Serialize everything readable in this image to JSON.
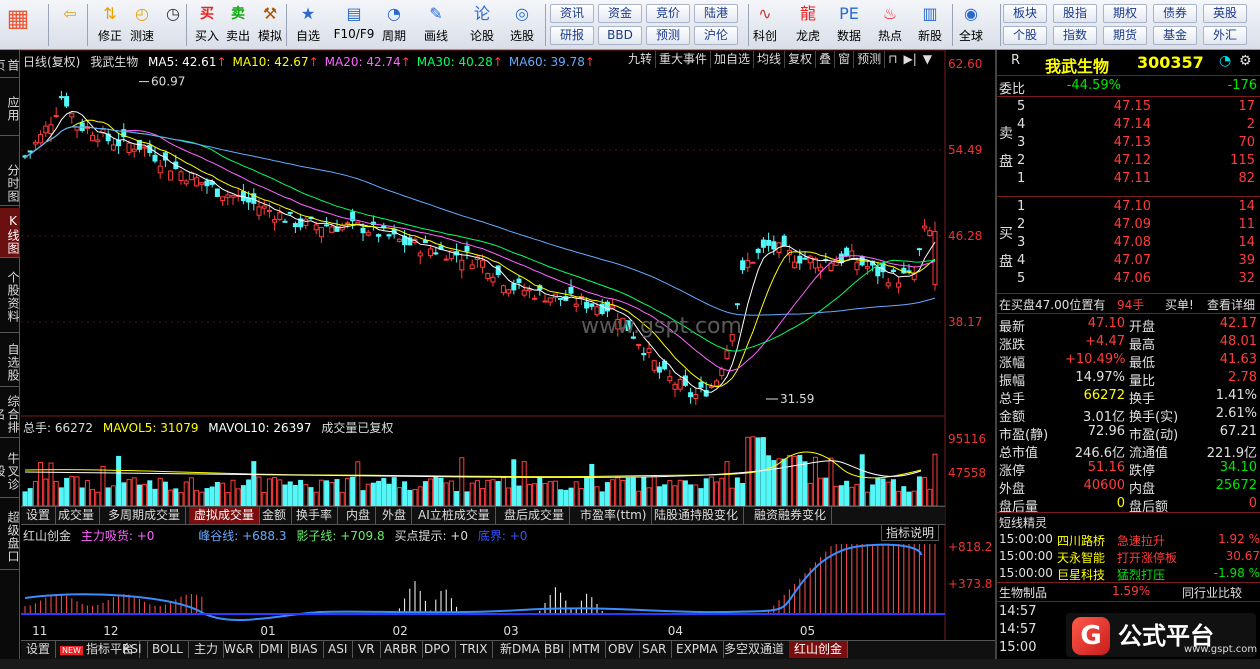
{
  "toolbar": {
    "buttons": [
      {
        "id": "layout",
        "label": "",
        "icon": "grid-icon"
      },
      {
        "id": "back",
        "label": "",
        "icon": "back-arrow-icon"
      },
      {
        "id": "revise",
        "label": "修正",
        "icon": "up-down-icon"
      },
      {
        "id": "test",
        "label": "测速",
        "icon": "speed-icon"
      },
      {
        "id": "stopwatch",
        "label": "",
        "icon": "clock-icon"
      },
      {
        "id": "buy",
        "label": "买入",
        "icon": "buy-icon"
      },
      {
        "id": "sell",
        "label": "卖出",
        "icon": "sell-icon"
      },
      {
        "id": "sim",
        "label": "模拟",
        "icon": "hammer-icon"
      },
      {
        "id": "fav",
        "label": "自选",
        "icon": "star-icon"
      },
      {
        "id": "f10",
        "label": "F10/F9",
        "icon": "info-icon"
      },
      {
        "id": "period",
        "label": "周期",
        "icon": "cycle-icon"
      },
      {
        "id": "draw",
        "label": "画线",
        "icon": "pencil-icon"
      },
      {
        "id": "forum",
        "label": "论股",
        "icon": "chat-icon"
      },
      {
        "id": "select",
        "label": "选股",
        "icon": "magnifier-icon"
      },
      {
        "id": "kechuang",
        "label": "科创",
        "icon": "chart-icon"
      },
      {
        "id": "dragon",
        "label": "龙虎",
        "icon": "dragon-icon"
      },
      {
        "id": "data",
        "label": "数据",
        "icon": "pe-icon"
      },
      {
        "id": "hot",
        "label": "热点",
        "icon": "fire-icon"
      },
      {
        "id": "newstock",
        "label": "新股",
        "icon": "doc-icon"
      },
      {
        "id": "global",
        "label": "全球",
        "icon": "globe-icon"
      }
    ],
    "grid": [
      [
        "资讯",
        "资金",
        "竞价",
        "陆港"
      ],
      [
        "研报",
        "BBD",
        "预测",
        "沪伦"
      ]
    ],
    "grid2": [
      [
        "板块",
        "股指",
        "期权",
        "债券",
        "基金"
      ],
      [
        "个股",
        "指数",
        "期货",
        "基金",
        "外汇"
      ]
    ],
    "grid2b": [
      "英股"
    ]
  },
  "sidebar": [
    "首页",
    "应用",
    "分时图",
    "K线图",
    "个股资料",
    "自选股",
    "综合排名",
    "牛叉诊股",
    "超级盘口"
  ],
  "chart": {
    "title": "日线(复权)",
    "stock_name": "我武生物",
    "ma": [
      {
        "label": "MA5: 42.61",
        "color": "#ffffff"
      },
      {
        "label": "MA10: 42.67",
        "color": "#ffff00"
      },
      {
        "label": "MA20: 42.74",
        "color": "#ff66ff"
      },
      {
        "label": "MA30: 40.28",
        "color": "#00ff66"
      },
      {
        "label": "MA60: 39.78",
        "color": "#66aaff"
      }
    ],
    "buttons": [
      "九转",
      "重大事件",
      "加自选",
      "均线",
      "复权",
      "叠",
      "窗",
      "预测"
    ],
    "axis": [
      "62.60",
      "54.49",
      "46.28",
      "38.17"
    ],
    "hi_label": "60.97",
    "lo_label": "31.59",
    "watermark": "www.gspt.com",
    "vol_legend": {
      "total": "总手: 66272",
      "mavol5": "MAVOL5: 31079",
      "mavol10": "MAVOL10: 26397",
      "note": "成交量已复权"
    },
    "vol_axis": [
      "95116",
      "47558"
    ],
    "ind_legend": {
      "name": "红山创金",
      "a": "主力吸货: +0",
      "b": "峰谷线: +688.3",
      "c": "影子线: +709.8",
      "d": "买点提示: +0",
      "e": "底界: +0"
    },
    "ind_axis": [
      "+818.2",
      "+373.8"
    ],
    "ind_btn": "指标说明",
    "dates": [
      {
        "l": "11",
        "x": 0.012
      },
      {
        "l": "12",
        "x": 0.089
      },
      {
        "l": "01",
        "x": 0.259
      },
      {
        "l": "02",
        "x": 0.402
      },
      {
        "l": "03",
        "x": 0.522
      },
      {
        "l": "04",
        "x": 0.7
      },
      {
        "l": "05",
        "x": 0.843
      }
    ]
  },
  "tabs": [
    "设置",
    "成交量",
    "多周期成交量",
    "虚拟成交量",
    "金额",
    "换手率",
    "内盘",
    "外盘",
    "AI立桩成交量",
    "盘后成交量",
    "市盈率(ttm)",
    "陆股通持股变化",
    "融资融券变化"
  ],
  "btabs": [
    "设置",
    "指标平台",
    "RSI",
    "BOLL",
    "主力",
    "W&R",
    "DMI",
    "BIAS",
    "ASI",
    "VR",
    "ARBR",
    "DPO",
    "TRIX",
    "新DMA",
    "BBI",
    "MTM",
    "OBV",
    "SAR",
    "EXPMA",
    "多空双通道",
    "红山创金"
  ],
  "quote": {
    "mark": "R",
    "name": "我武生物",
    "code": "300357",
    "weibi": "委比",
    "weibi_pct": "-44.59%",
    "weibi_n": "-176",
    "sell": [
      [
        "5",
        "47.15",
        "17"
      ],
      [
        "4",
        "47.14",
        "2"
      ],
      [
        "3",
        "47.13",
        "70"
      ],
      [
        "2",
        "47.12",
        "115"
      ],
      [
        "1",
        "47.11",
        "82"
      ]
    ],
    "buy": [
      [
        "1",
        "47.10",
        "14"
      ],
      [
        "2",
        "47.09",
        "11"
      ],
      [
        "3",
        "47.08",
        "14"
      ],
      [
        "4",
        "47.07",
        "39"
      ],
      [
        "5",
        "47.06",
        "32"
      ]
    ],
    "sell_side": "卖盘",
    "buy_side": "买盘",
    "note": "在买盘47.00位置有",
    "note_n": "94手",
    "note_b": "买单!",
    "note_c": "查看详细",
    "stats": [
      [
        "最新",
        "47.10",
        "开盘",
        "42.17"
      ],
      [
        "涨跌",
        "+4.47",
        "最高",
        "48.01"
      ],
      [
        "涨幅",
        "+10.49%",
        "最低",
        "41.63"
      ],
      [
        "振幅",
        "14.97%",
        "量比",
        "2.78"
      ],
      [
        "总手",
        "66272",
        "换手",
        "1.41%"
      ],
      [
        "金额",
        "3.01亿",
        "换手(实)",
        "2.61%"
      ],
      [
        "市盈(静)",
        "72.96",
        "市盈(动)",
        "67.21"
      ],
      [
        "总市值",
        "246.6亿",
        "流通值",
        "221.9亿"
      ],
      [
        "涨停",
        "51.16",
        "跌停",
        "34.10"
      ],
      [
        "外盘",
        "40600",
        "内盘",
        "25672"
      ],
      [
        "盘后量",
        "0",
        "盘后额",
        "0"
      ]
    ],
    "elf_title": "短线精灵",
    "elf": [
      [
        "15:00:00",
        "四川路桥",
        "急速拉升",
        "1.92 %"
      ],
      [
        "15:00:00",
        "天永智能",
        "打开涨停板",
        "30.67"
      ],
      [
        "15:00:00",
        "巨星科技",
        "猛烈打压",
        "-1.98 %"
      ]
    ],
    "industry": "生物制品",
    "industry_pct": "1.59%",
    "industry_btn": "同行业比较",
    "times": [
      "14:57",
      "14:57",
      "15:00"
    ]
  },
  "logo": "公式平台",
  "logo_url": "www.gspt.com"
}
